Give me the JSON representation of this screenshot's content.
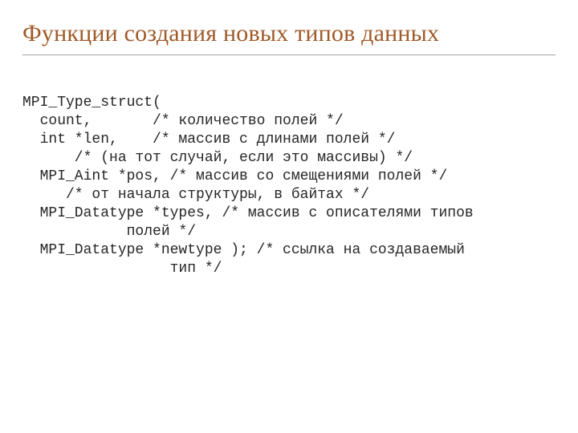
{
  "title": "Функции создания новых типов данных",
  "code": {
    "l1": "MPI_Type_struct(",
    "l2": "  count,       /* количество полей */",
    "l3": "  int *len,    /* массив с длинами полей */",
    "l4": "      /* (на тот случай, если это массивы) */",
    "l5": "  MPI_Aint *pos, /* массив со смещениями полей */",
    "l6": "     /* от начала структуры, в байтах */",
    "l7": "  MPI_Datatype *types, /* массив с описателями типов",
    "l8": "            полей */",
    "l9": "  MPI_Datatype *newtype ); /* ссылка на создаваемый",
    "l10": "                 тип */"
  }
}
